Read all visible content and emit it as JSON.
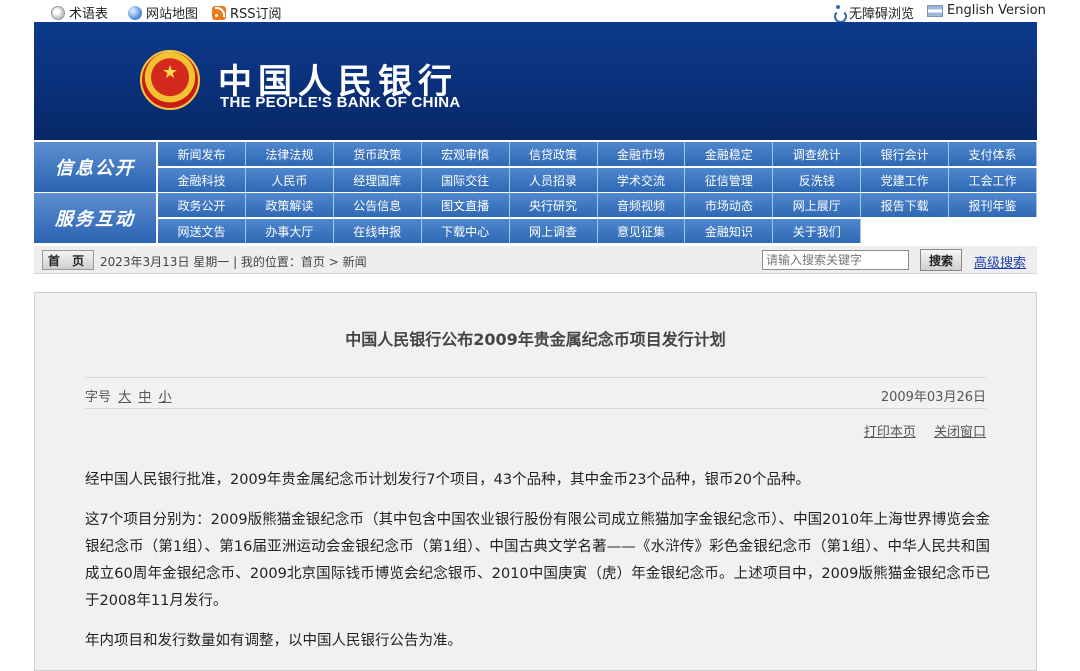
{
  "topbar": {
    "left": [
      {
        "icon": "glossary-icon",
        "label": "术语表"
      },
      {
        "icon": "globe-icon",
        "label": "网站地图"
      },
      {
        "icon": "rss-icon",
        "label": "RSS订阅"
      }
    ],
    "right": [
      {
        "icon": "accessibility-icon",
        "label": "无障碍浏览"
      },
      {
        "icon": "flag-icon",
        "label": "English Version"
      }
    ]
  },
  "header": {
    "logo_icon": "national-emblem-icon",
    "title_cn": "中国人民银行",
    "title_en": "THE PEOPLE'S BANK OF CHINA"
  },
  "nav": {
    "groups": [
      {
        "title": "信息公开",
        "items": [
          "新闻发布",
          "法律法规",
          "货币政策",
          "宏观审慎",
          "信贷政策",
          "金融市场",
          "金融稳定",
          "调查统计",
          "银行会计",
          "支付体系",
          "金融科技",
          "人民币",
          "经理国库",
          "国际交往",
          "人员招录",
          "学术交流",
          "征信管理",
          "反洗钱",
          "党建工作",
          "工会工作"
        ]
      },
      {
        "title": "服务互动",
        "items": [
          "政务公开",
          "政策解读",
          "公告信息",
          "图文直播",
          "央行研究",
          "音频视频",
          "市场动态",
          "网上展厅",
          "报告下载",
          "报刊年鉴",
          "网送文告",
          "办事大厅",
          "在线申报",
          "下载中心",
          "网上调查",
          "意见征集",
          "金融知识",
          "关于我们",
          "",
          ""
        ]
      }
    ]
  },
  "breadcrumb": {
    "home_label": "首 页",
    "text": "2023年3月13日 星期一 | 我的位置：首页 > 新闻",
    "search_placeholder": "请输入搜索关键字",
    "search_button": "搜索",
    "advanced_search": "高级搜索"
  },
  "article": {
    "title": "中国人民银行公布2009年贵金属纪念币项目发行计划",
    "font_size_label": "字号",
    "font_sizes": [
      "大",
      "中",
      "小"
    ],
    "date": "2009年03月26日",
    "print_label": "打印本页",
    "close_label": "关闭窗口",
    "paragraphs": [
      "经中国人民银行批准，2009年贵金属纪念币计划发行7个项目，43个品种，其中金币23个品种，银币20个品种。",
      "这7个项目分别为：2009版熊猫金银纪念币（其中包含中国农业银行股份有限公司成立熊猫加字金银纪念币）、中国2010年上海世界博览会金银纪念币（第1组）、第16届亚洲运动会金银纪念币（第1组）、中国古典文学名著——《水浒传》彩色金银纪念币（第1组）、中华人民共和国成立60周年金银纪念币、2009北京国际钱币博览会纪念银币、2010中国庚寅（虎）年金银纪念币。上述项目中，2009版熊猫金银纪念币已于2008年11月发行。",
      "年内项目和发行数量如有调整，以中国人民银行公告为准。"
    ]
  }
}
